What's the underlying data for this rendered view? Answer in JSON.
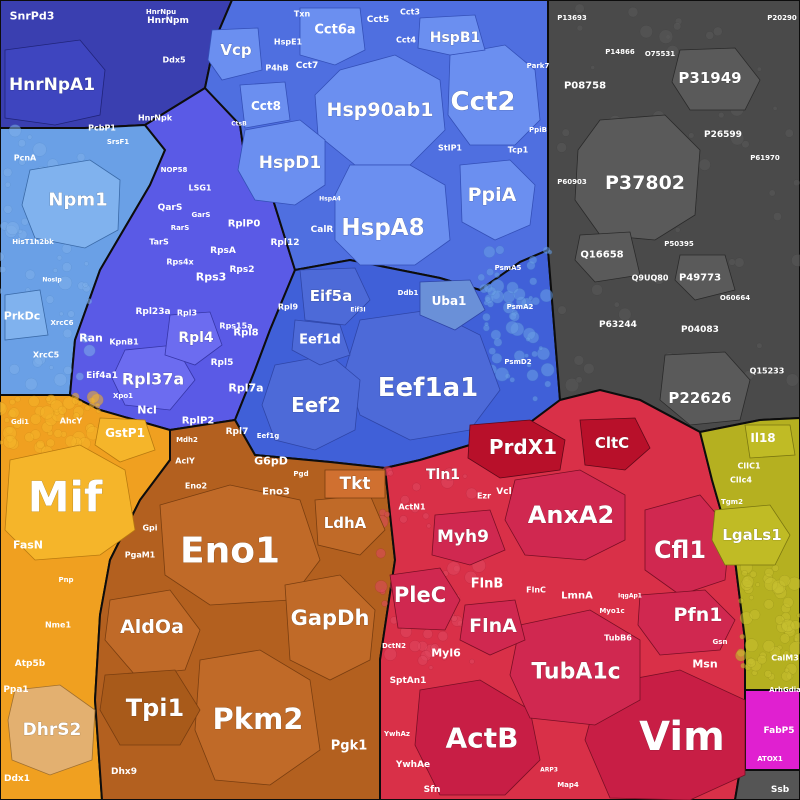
{
  "regions": [
    {
      "key": "blue-top",
      "color": "#4f6fe0"
    },
    {
      "key": "dark-navy",
      "color": "#3a3fb0"
    },
    {
      "key": "light-blue",
      "color": "#6aa0e6"
    },
    {
      "key": "violet",
      "color": "#5a5ae6"
    },
    {
      "key": "gray",
      "color": "#4a4a4a"
    },
    {
      "key": "orange",
      "color": "#f0a020"
    },
    {
      "key": "brown",
      "color": "#b3601f"
    },
    {
      "key": "red",
      "color": "#d93048"
    },
    {
      "key": "olive",
      "color": "#b5b020"
    },
    {
      "key": "magenta",
      "color": "#e020d0"
    },
    {
      "key": "darkgray",
      "color": "#555555"
    }
  ],
  "labels": {
    "hsp90ab1": "Hsp90ab1",
    "hspa8": "HspA8",
    "cct2": "Cct2",
    "hspd1": "HspD1",
    "ppia": "PpiA",
    "cct6a": "Cct6a",
    "hspb1": "HspB1",
    "vcp": "Vcp",
    "cct8": "Cct8",
    "cct7": "Cct7",
    "cct5": "Cct5",
    "cct3": "Cct3",
    "cct4": "Cct4",
    "hspe1": "HspE1",
    "txn": "Txn",
    "p4hb": "P4hB",
    "calr": "CalR",
    "stip1": "StIP1",
    "tcp1": "Tcp1",
    "ppib": "PpiB",
    "park7": "Park7",
    "hspa4": "HspA4",
    "eef1a1": "Eef1a1",
    "eef2": "Eef2",
    "eif5a": "Eif5a",
    "eef1d": "Eef1d",
    "uba1": "Uba1",
    "psma5": "PsmA5",
    "psma2": "PsmA2",
    "psmd2": "PsmD2",
    "ddb1": "Ddb1",
    "eef1g": "Eef1g",
    "eif3i": "Eif3I",
    "hnrnpa1": "HnrNpA1",
    "snrpd3": "SnrPd3",
    "hnrnpm": "HnrNpm",
    "hnrnpu": "HnrNpu",
    "ddx5": "Ddx5",
    "hnrnpk": "HnrNpk",
    "pcbp1": "PcbP1",
    "srsf1": "SrsF1",
    "npm1": "Npm1",
    "prkdc": "PrkDc",
    "ran": "Ran",
    "eif4a1": "Eif4a1",
    "pcna": "PcnA",
    "xrcc5": "XrcC5",
    "xrcc6": "XrcC6",
    "hist1h2bk": "HisT1h2bk",
    "kpnb1": "KpnB1",
    "xpo1": "Xpo1",
    "ncl": "Ncl",
    "nosip": "NosIp",
    "gdi": "Gdi1",
    "rpl37a": "Rpl37a",
    "rpl4": "Rpl4",
    "rps3": "Rps3",
    "rplp0": "RplP0",
    "rplp2": "RplP2",
    "rpl7": "Rpl7",
    "rpl7a": "Rpl7a",
    "rpl5": "Rpl5",
    "rpl8": "Rpl8",
    "rpl23a": "Rpl23a",
    "rpl3": "Rpl3",
    "rpl12": "Rpl12",
    "rps2": "Rps2",
    "rpsa": "RpsA",
    "rps4x": "Rps4x",
    "rps15a": "Rps15a",
    "rpl9": "Rpl9",
    "qars": "QarS",
    "lsg1": "LSG1",
    "nop58": "NOP58",
    "rars": "RarS",
    "tars": "TarS",
    "gars": "GarS",
    "p37802": "P37802",
    "p31949": "P31949",
    "p22626": "P22626",
    "q16658": "Q16658",
    "p49773": "P49773",
    "p08758": "P08758",
    "p26599": "P26599",
    "p63244": "P63244",
    "p04083": "P04083",
    "q9uq80": "Q9UQ80",
    "p60903": "P60903",
    "p13693": "P13693",
    "p14866": "P14866",
    "o75531": "O75531",
    "q15233": "Q15233",
    "p61970": "P61970",
    "p50395": "P50395",
    "o60664": "O60664",
    "p20290": "P20290",
    "mif": "Mif",
    "gstp1": "GstP1",
    "fasn": "FasN",
    "dhrs2": "DhrS2",
    "ahcy": "AhcY",
    "nme1": "Nme1",
    "atp5b": "Atp5b",
    "ppa1": "Ppa1",
    "ddx1": "Ddx1",
    "pnp": "Pnp",
    "eno1": "Eno1",
    "aldoa": "AldOa",
    "gapdh": "GapDh",
    "pkm2": "Pkm2",
    "tpi1": "Tpi1",
    "ldha": "LdhA",
    "tkt": "Tkt",
    "pgk1": "Pgk1",
    "g6pd": "G6pD",
    "eno3": "Eno3",
    "eno2": "Eno2",
    "pgam1": "PgaM1",
    "acly": "AclY",
    "mdh2": "Mdh2",
    "gpi": "Gpi",
    "dhx9": "Dhx9",
    "pgd": "Pgd",
    "actb": "ActB",
    "vim": "Vim",
    "tuba1c": "TubA1c",
    "anxa2": "AnxA2",
    "cfl1": "Cfl1",
    "pfn1": "Pfn1",
    "plec": "PleC",
    "flna": "FlnA",
    "flnb": "FlnB",
    "myh9": "Myh9",
    "tln1": "Tln1",
    "prdx1": "PrdX1",
    "cltc": "CltC",
    "msn": "Msn",
    "myl6": "Myl6",
    "lmna": "LmnA",
    "sptan1": "SptAn1",
    "ywhae": "YwhAe",
    "sfn": "Sfn",
    "ezr": "Ezr",
    "vcl": "Vcl",
    "actn1": "ActN1",
    "flnc": "FlnC",
    "tubb6": "TubB6",
    "map4": "Map4",
    "myo1c": "Myo1c",
    "ywhaz": "YwhAz",
    "dctn2": "DctN2",
    "iqgap1": "IqgAp1",
    "gsn": "Gsn",
    "arp3": "ARP3",
    "lgals1": "LgaLs1",
    "il18": "Il18",
    "clic1": "ClIC1",
    "clic4": "ClIc4",
    "tgm2": "Tgm2",
    "calm3": "CalM3",
    "arhgdia": "ArhGdia",
    "fabp5": "FabP5",
    "atox1": "ATOX1",
    "ssb": "Ssb",
    "ctsb": "CtsB"
  }
}
